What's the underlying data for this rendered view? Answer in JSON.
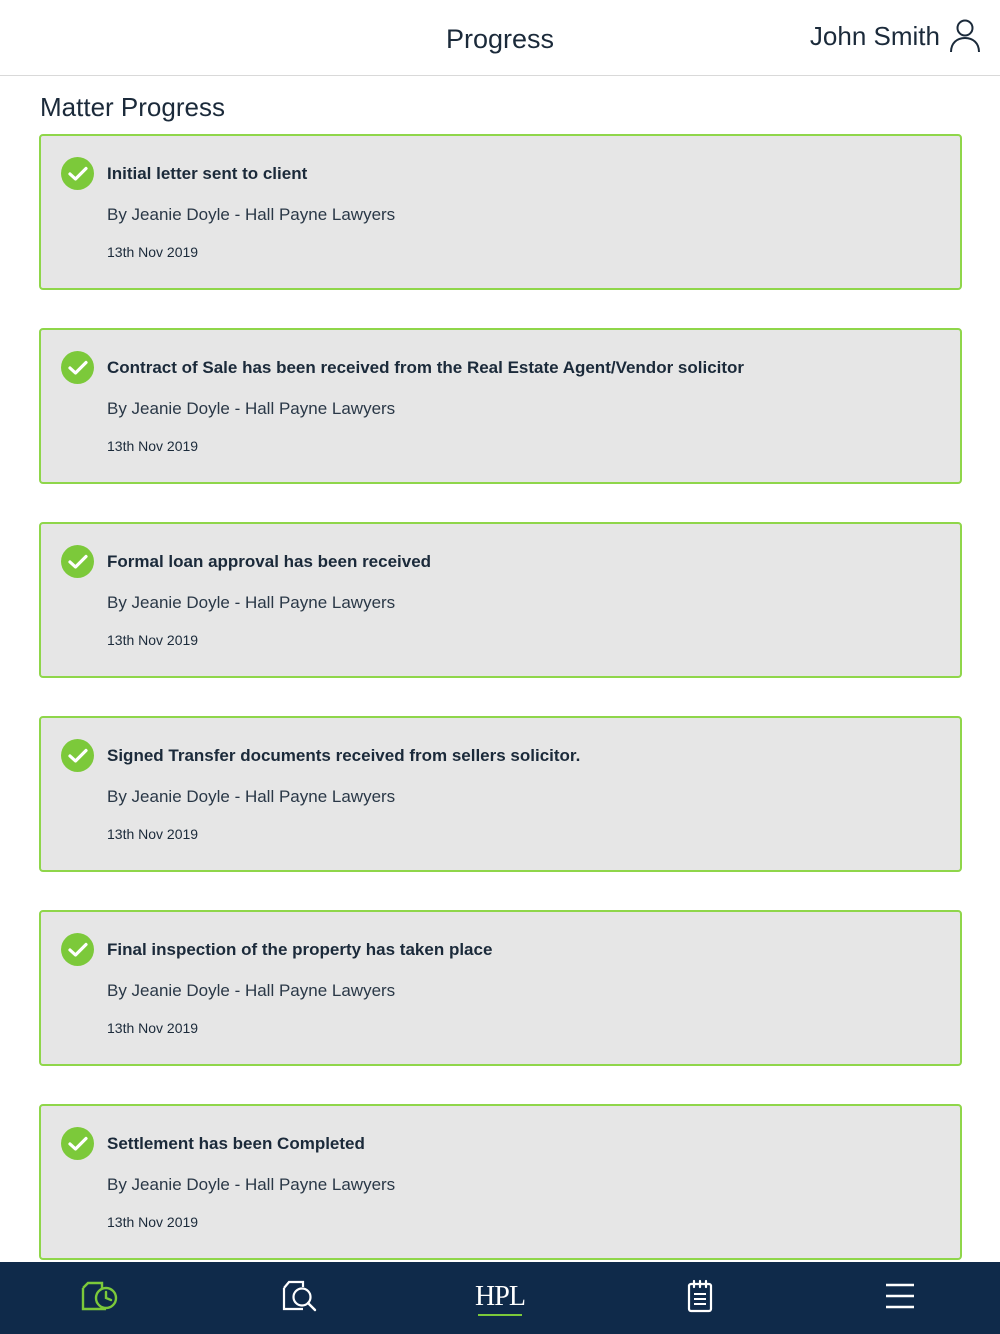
{
  "header": {
    "title": "Progress",
    "user_name": "John Smith"
  },
  "section": {
    "title": "Matter Progress"
  },
  "items": [
    {
      "title": "Initial letter sent to client",
      "by": "By Jeanie Doyle - Hall Payne Lawyers",
      "date": "13th Nov 2019"
    },
    {
      "title": "Contract of Sale has been received from the Real Estate Agent/Vendor solicitor",
      "by": "By Jeanie Doyle - Hall Payne Lawyers",
      "date": "13th Nov 2019"
    },
    {
      "title": "Formal loan approval has been received",
      "by": "By Jeanie Doyle - Hall Payne Lawyers",
      "date": "13th Nov 2019"
    },
    {
      "title": "Signed Transfer documents received from sellers solicitor.",
      "by": "By Jeanie Doyle - Hall Payne Lawyers",
      "date": "13th Nov 2019"
    },
    {
      "title": "Final inspection of the property has taken place",
      "by": "By Jeanie Doyle - Hall Payne Lawyers",
      "date": "13th Nov 2019"
    },
    {
      "title": "Settlement has been Completed",
      "by": "By Jeanie Doyle - Hall Payne Lawyers",
      "date": "13th Nov 2019"
    }
  ],
  "bottom_nav": {
    "logo_text": "HPL",
    "items": [
      "progress-icon",
      "search-document-icon",
      "hpl-logo",
      "notepad-icon",
      "menu-icon"
    ]
  },
  "colors": {
    "accent_green": "#7cc93a",
    "nav_background": "#0f2a4a",
    "card_background": "#e6e6e6"
  }
}
